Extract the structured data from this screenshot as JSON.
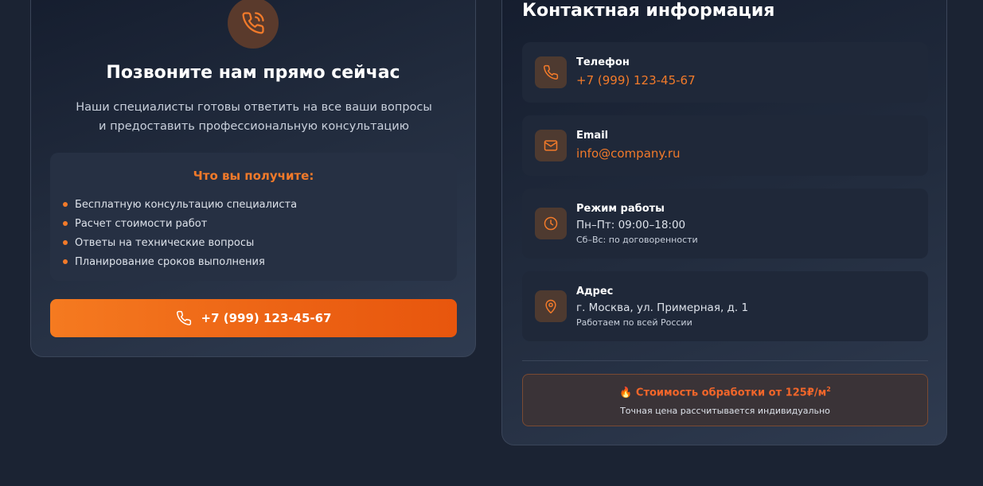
{
  "call": {
    "title": "Позвоните нам прямо сейчас",
    "description": "Наши специалисты готовы ответить на все ваши вопросы и предоставить профессиональную консультацию",
    "benefits_title": "Что вы получите:",
    "benefits": [
      "Бесплатную консультацию специалиста",
      "Расчет стоимости работ",
      "Ответы на технические вопросы",
      "Планирование сроков выполнения"
    ],
    "button_label": "+7 (999) 123-45-67",
    "icon": "phone-ringing-icon"
  },
  "contacts": {
    "title": "Контактная информация",
    "items": [
      {
        "icon": "phone-icon",
        "label": "Телефон",
        "value": "+7 (999) 123-45-67"
      },
      {
        "icon": "mail-icon",
        "label": "Email",
        "value": "info@company.ru"
      },
      {
        "icon": "clock-icon",
        "label": "Режим работы",
        "value": "Пн–Пт: 09:00–18:00",
        "note": "Сб–Вс: по договоренности"
      },
      {
        "icon": "map-pin-icon",
        "label": "Адрес",
        "value": "г. Москва, ул. Примерная, д. 1",
        "note": "Работаем по всей России"
      }
    ],
    "price": {
      "emoji": "🔥",
      "text": "Стоимость обработки от 125₽/м",
      "superscript": "2",
      "subtext": "Точная цена рассчитывается индивидуально"
    }
  },
  "colors": {
    "accent": "#f27a2a",
    "background": "#1b2333",
    "card": "#1f2839"
  }
}
